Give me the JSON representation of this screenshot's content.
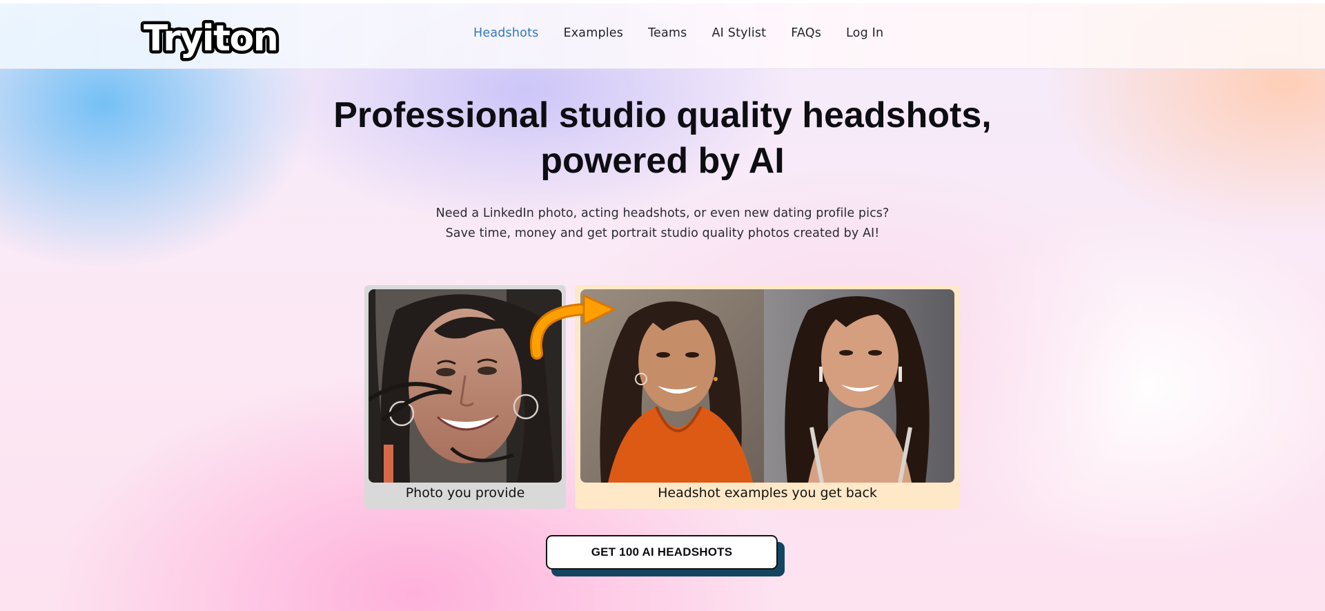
{
  "brand": {
    "logo_text": "Tryiton"
  },
  "nav": {
    "items": [
      {
        "label": "Headshots",
        "active": true
      },
      {
        "label": "Examples"
      },
      {
        "label": "Teams"
      },
      {
        "label": "AI Stylist"
      },
      {
        "label": "FAQs"
      },
      {
        "label": "Log In"
      }
    ],
    "active_color": "#2f78c4"
  },
  "hero": {
    "title_line1": "Professional studio quality headshots,",
    "title_line2": "powered by AI",
    "subtitle_line1": "Need a LinkedIn photo, acting headshots, or even new dating profile pics?",
    "subtitle_line2": "Save time, money and get portrait studio quality photos created by AI!"
  },
  "examples": {
    "provided_caption": "Photo you provide",
    "results_caption": "Headshot examples you get back",
    "provided_bg": "#d9d9d9",
    "results_bg": "#ffe8c7",
    "arrow_color": "#ffa000"
  },
  "cta": {
    "label": "GET 100 AI HEADSHOTS"
  }
}
